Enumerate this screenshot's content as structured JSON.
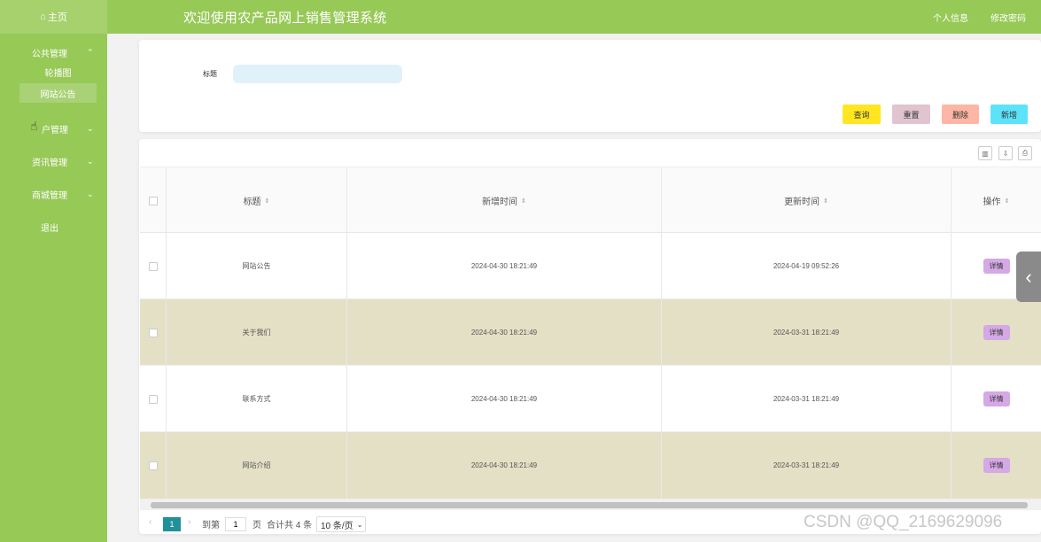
{
  "header": {
    "home_icon": "home-icon",
    "home_label": "主页",
    "title": "欢迎使用农产品网上销售管理系统",
    "profile_link": "个人信息",
    "password_link": "修改密码",
    "colors": {
      "bar": "#97c957",
      "text": "#ffffff"
    }
  },
  "sidebar": {
    "groups": [
      {
        "label": "公共管理",
        "expanded": true,
        "sub_items": [
          {
            "label": "轮播图",
            "active": false
          },
          {
            "label": "网站公告",
            "active": true
          }
        ]
      },
      {
        "label": "用户管理",
        "expanded": false
      },
      {
        "label": "资讯管理",
        "expanded": false
      },
      {
        "label": "商城管理",
        "expanded": false
      }
    ],
    "logout": "退出",
    "visible_user_group_label": "户管理"
  },
  "search": {
    "label": "标题",
    "value": "",
    "placeholder": ""
  },
  "actions": {
    "query": "查询",
    "reset": "重置",
    "delete": "删除",
    "add": "新增",
    "colors": {
      "query": "#ffe620",
      "reset": "#e0c4cf",
      "delete": "#fdb6a5",
      "add": "#5ce3fa"
    }
  },
  "table_tools": [
    "filter-columns-icon",
    "export-icon",
    "print-icon"
  ],
  "table": {
    "columns": [
      "标题",
      "新增时间",
      "更新时间",
      "操作"
    ],
    "rows": [
      {
        "title": "网站公告",
        "created": "2024-04-30 18:21:49",
        "updated": "2024-04-19 09:52:26",
        "action": "详情"
      },
      {
        "title": "关于我们",
        "created": "2024-04-30 18:21:49",
        "updated": "2024-03-31 18:21:49",
        "action": "详情"
      },
      {
        "title": "联系方式",
        "created": "2024-04-30 18:21:49",
        "updated": "2024-03-31 18:21:49",
        "action": "详情"
      },
      {
        "title": "网站介绍",
        "created": "2024-04-30 18:21:49",
        "updated": "2024-03-31 18:21:49",
        "action": "详情"
      }
    ],
    "colors": {
      "alt_row": "#e3e0c5",
      "detail_button": "#d5a8e6"
    }
  },
  "pagination": {
    "prev": "‹",
    "current_page": "1",
    "next": "›",
    "goto_prefix": "到第",
    "goto_value": "1",
    "goto_suffix": "页",
    "total": "合计共 4 条",
    "page_size": "10 条/页"
  },
  "watermark": "CSDN @QQ_2169629096"
}
